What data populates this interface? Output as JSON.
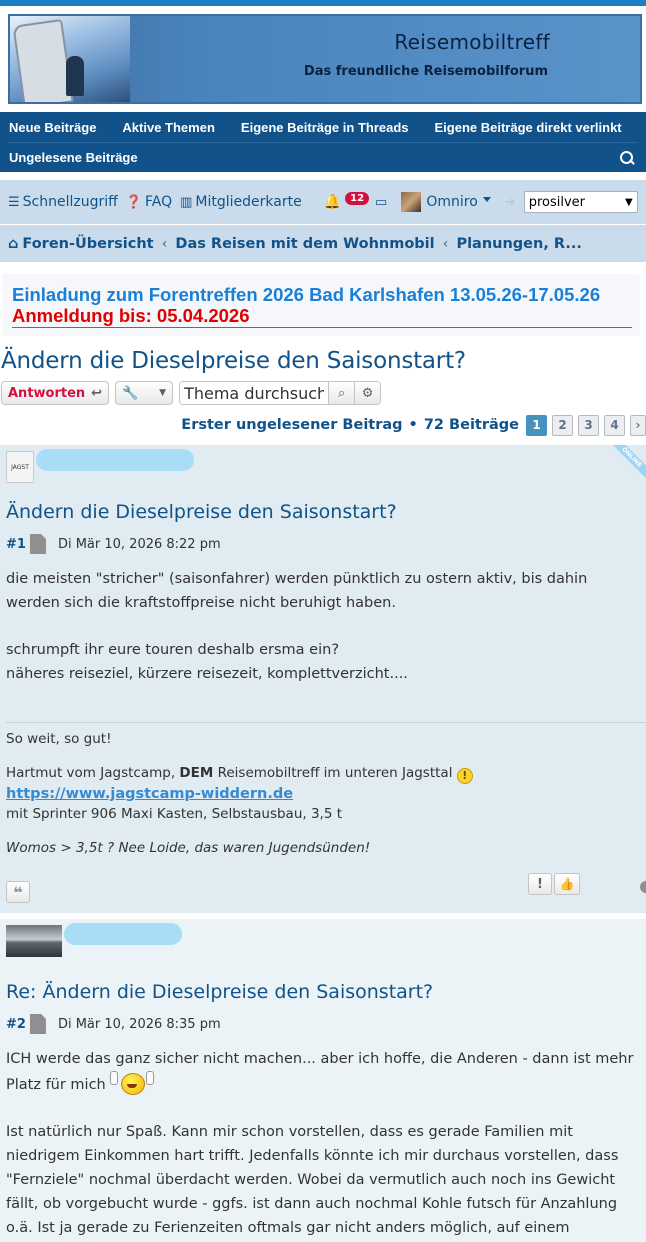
{
  "banner": {
    "title": "Reisemobiltreff",
    "subtitle": "Das freundliche Reisemobilforum"
  },
  "nav": {
    "row1": [
      "Neue Beiträge",
      "Aktive Themen",
      "Eigene Beiträge in Threads",
      "Eigene Beiträge direkt verlinkt"
    ],
    "row2": [
      "Ungelesene Beiträge"
    ]
  },
  "toolbar": {
    "quick_access": "Schnellzugriff",
    "faq": "FAQ",
    "members_map": "Mitgliederkarte",
    "notifications_count": "12",
    "username": "Omniro",
    "style_select": "prosilver"
  },
  "breadcrumb": [
    "Foren-Übersicht",
    "Das Reisen mit dem Wohnmobil",
    "Planungen, R..."
  ],
  "announcement": {
    "text": "Einladung zum Forentreffen 2026 Bad Karlshafen 13.05.26-17.05.26",
    "deadline": "Anmeldung bis: 05.04.2026"
  },
  "topic": {
    "title": "Ändern die Dieselpreise den Saisonstart?",
    "reply_label": "Antworten",
    "search_value": "Thema durchsuchen",
    "first_unread": "Erster ungelesener Beitrag",
    "post_count": "72 Beiträge",
    "pages": [
      "1",
      "2",
      "3",
      "4"
    ]
  },
  "posts": [
    {
      "title": "Ändern die Dieselpreise den Saisonstart?",
      "number": "#1",
      "date": "Di Mär 10, 2026 8:22 pm",
      "online_label": "ONLINE",
      "body": [
        "die meisten \"stricher\" (saisonfahrer) werden pünktlich zu ostern aktiv, bis dahin werden sich die kraftstoffpreise nicht beruhigt haben.",
        "schrumpft ihr eure touren deshalb ersma ein?",
        "näheres reiseziel, kürzere reisezeit, komplettverzicht...."
      ],
      "signature": {
        "line1": "So weit, so gut!",
        "line2_pre": "Hartmut vom Jagstcamp,",
        "line2_bold": "DEM",
        "line2_post": "Reisemobiltreff im unteren Jagsttal",
        "link": "https://www.jagstcamp-widdern.de",
        "line3": "mit Sprinter 906 Maxi Kasten, Selbstausbau, 3,5 t",
        "line4": "Womos > 3,5t ? Nee Loide, das waren Jugendsünden!"
      }
    },
    {
      "title": "Re: Ändern die Dieselpreise den Saisonstart?",
      "number": "#2",
      "date": "Di Mär 10, 2026 8:35 pm",
      "body1": "ICH werde das ganz sicher nicht machen... aber ich hoffe, die Anderen - dann ist mehr Platz für mich",
      "body2": "Ist natürlich nur Spaß. Kann mir schon vorstellen, dass es gerade Familien mit niedrigem Einkommen hart trifft. Jedenfalls könnte ich mir durchaus vorstellen, dass \"Fernziele\" nochmal überdacht werden. Wobei da vermutlich auch noch ins Gewicht fällt, ob vorgebucht wurde - ggfs. ist dann auch nochmal Kohle futsch für Anzahlung o.ä. Ist ja gerade zu Ferienzeiten oftmals gar nicht anders möglich, auf einem begehrten CP unterzukommen."
    }
  ]
}
